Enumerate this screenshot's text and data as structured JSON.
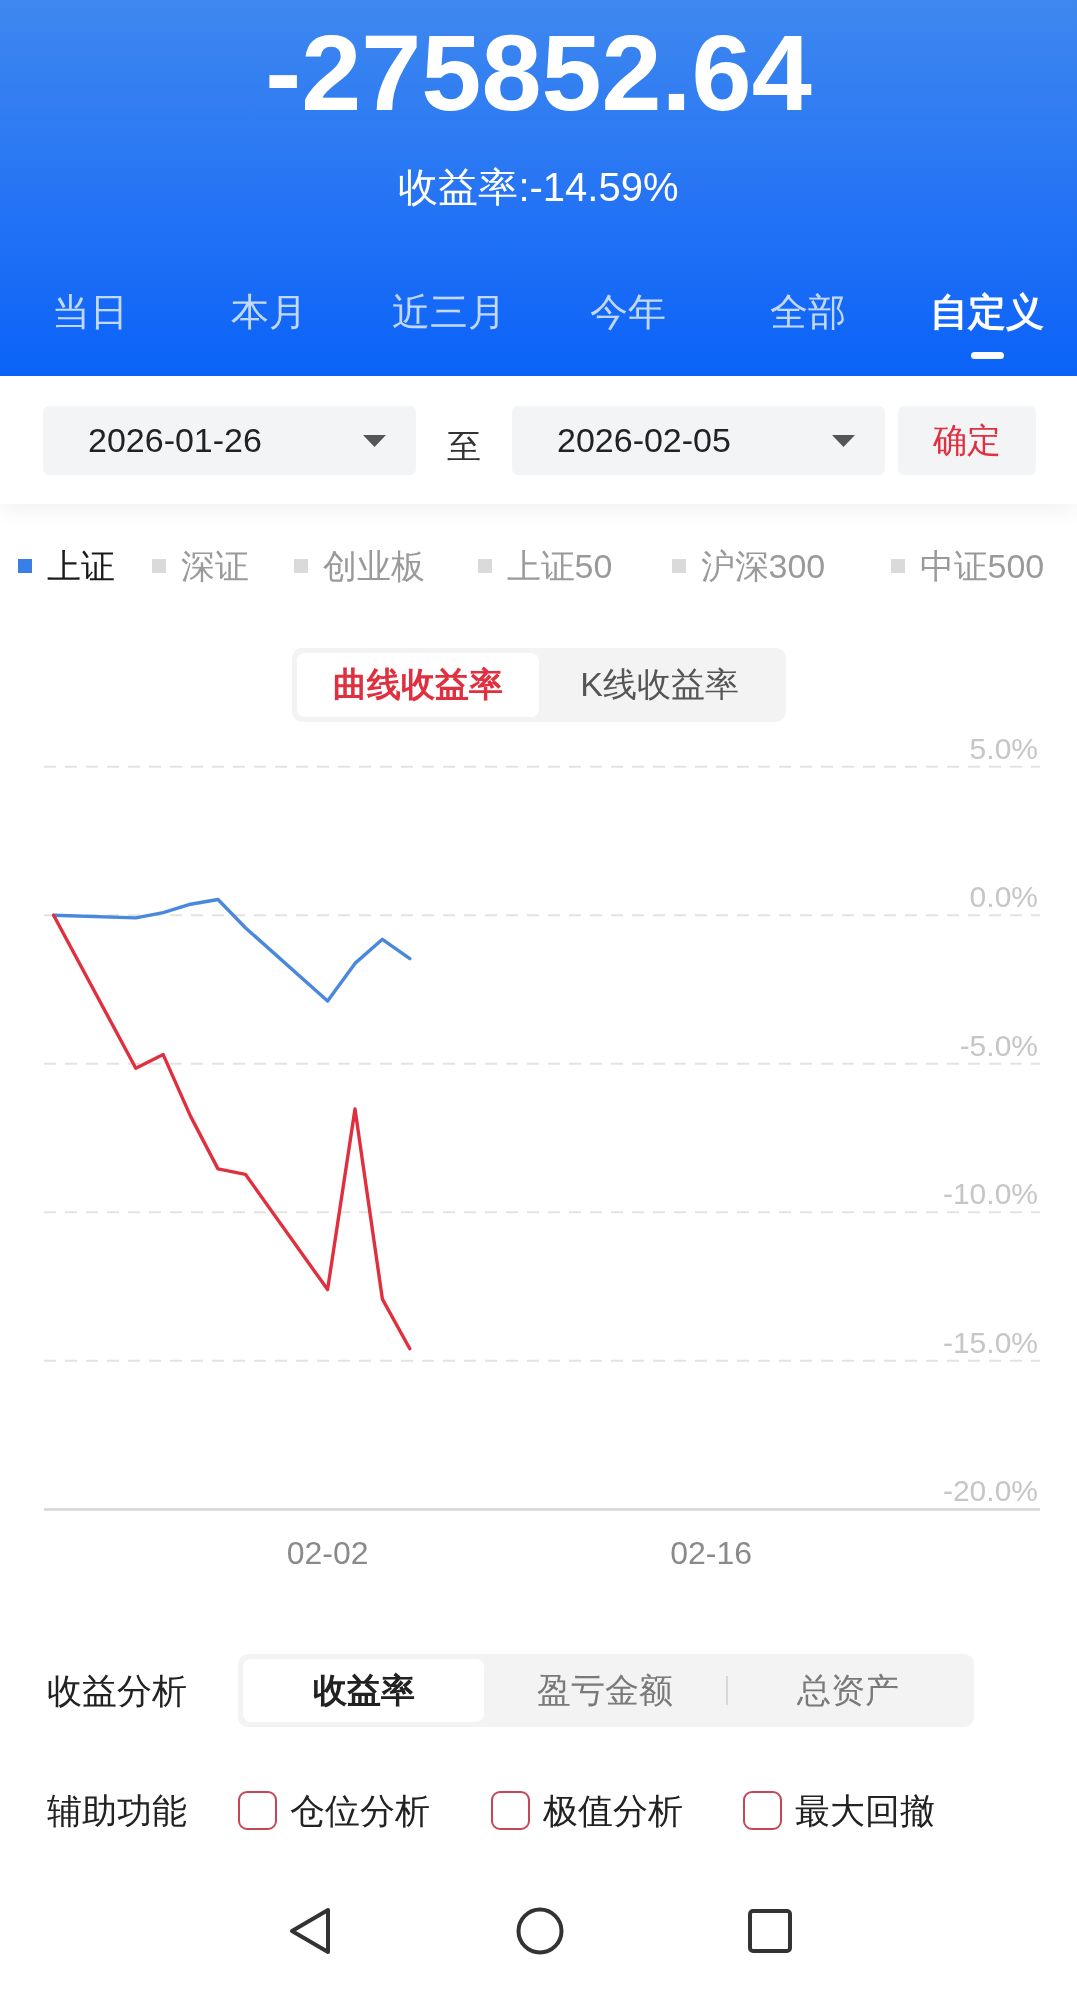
{
  "summary": {
    "amount": "-275852.64",
    "return_rate": "收益率:-14.59%"
  },
  "period_tabs": [
    {
      "label": "当日",
      "selected": false
    },
    {
      "label": "本月",
      "selected": false
    },
    {
      "label": "近三月",
      "selected": false
    },
    {
      "label": "今年",
      "selected": false
    },
    {
      "label": "全部",
      "selected": false
    },
    {
      "label": "自定义",
      "selected": true
    }
  ],
  "date_range": {
    "start": "2026-01-26",
    "separator": "至",
    "end": "2026-02-05",
    "confirm": "确定"
  },
  "index_options": [
    {
      "label": "上证",
      "selected": true
    },
    {
      "label": "深证",
      "selected": false
    },
    {
      "label": "创业板",
      "selected": false
    },
    {
      "label": "上证50",
      "selected": false
    },
    {
      "label": "沪深300",
      "selected": false
    },
    {
      "label": "中证500",
      "selected": false
    }
  ],
  "chart_modes": [
    {
      "label": "曲线收益率",
      "selected": true
    },
    {
      "label": "K线收益率",
      "selected": false
    }
  ],
  "chart": {
    "chart_data": {
      "type": "line",
      "grid": true,
      "categories": [
        null,
        null,
        null,
        null,
        null,
        null,
        null,
        null,
        null,
        null,
        "02-02",
        null,
        null,
        null,
        null,
        null,
        null,
        null,
        null,
        null,
        null,
        null,
        null,
        null,
        "02-16",
        null,
        null,
        null,
        null,
        null,
        null,
        null,
        null,
        null,
        null,
        null,
        null
      ],
      "ylim": [
        -20,
        5
      ],
      "yticks": [
        {
          "value": 5,
          "label": "5.0%"
        },
        {
          "value": 0,
          "label": "0.0%"
        },
        {
          "value": -5,
          "label": "-5.0%"
        },
        {
          "value": -10,
          "label": "-10.0%"
        },
        {
          "value": -15,
          "label": "-15.0%"
        },
        {
          "value": -20,
          "label": "-20.0%"
        }
      ],
      "series": [
        {
          "color": "#4a88dc",
          "values": [
            0,
            null,
            null,
            -0.09,
            0.09,
            0.37,
            0.53,
            -0.42,
            null,
            null,
            -2.89,
            -1.62,
            -0.81,
            -1.46,
            null,
            null,
            null,
            null,
            null,
            null,
            null,
            null,
            null,
            null,
            null,
            null,
            null,
            null,
            null,
            null,
            null,
            null,
            null,
            null,
            null,
            null,
            null
          ]
        },
        {
          "color": "#e0303f",
          "values": [
            0,
            null,
            null,
            -5.15,
            -4.69,
            -6.77,
            -8.54,
            -8.72,
            null,
            null,
            -12.6,
            -6.52,
            -12.92,
            -14.59,
            null,
            null,
            null,
            null,
            null,
            null,
            null,
            null,
            null,
            null,
            null,
            null,
            null,
            null,
            null,
            null,
            null,
            null,
            null,
            null,
            null,
            null,
            null
          ]
        }
      ]
    }
  },
  "analysis": {
    "label": "收益分析",
    "options": [
      {
        "label": "收益率",
        "selected": true
      },
      {
        "label": "盈亏金额",
        "selected": false
      },
      {
        "label": "总资产",
        "selected": false
      }
    ]
  },
  "tools": {
    "label": "辅助功能",
    "options": [
      {
        "label": "仓位分析",
        "checked": false
      },
      {
        "label": "极值分析",
        "checked": false
      },
      {
        "label": "最大回撤",
        "checked": false
      }
    ]
  }
}
